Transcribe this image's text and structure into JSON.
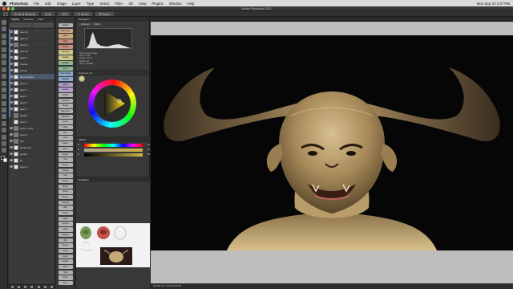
{
  "menubar": {
    "items": [
      "Photoshop",
      "File",
      "Edit",
      "Image",
      "Layer",
      "Type",
      "Select",
      "Filter",
      "3D",
      "View",
      "Plugins",
      "Window",
      "Help"
    ],
    "clock": "Mon Sep 23  2:37 PM"
  },
  "window": {
    "title": "Adobe Photoshop 2021"
  },
  "optionsbar": {
    "items": [
      "Scroll All Windows",
      "Zoom",
      "100%",
      "Fit Screen",
      "Fill Screen"
    ]
  },
  "layers": {
    "tabs": [
      "Layers",
      "Channels",
      "Paths"
    ],
    "rows": [
      {
        "name": "layer 12",
        "type": "layer",
        "visible": true,
        "selected": false
      },
      {
        "name": "layer 11",
        "type": "layer",
        "visible": true,
        "selected": false
      },
      {
        "name": "Group 1",
        "type": "folder",
        "visible": true,
        "selected": false
      },
      {
        "name": "layer 10",
        "type": "layer",
        "visible": true,
        "selected": false
      },
      {
        "name": "layer 9",
        "type": "layer",
        "visible": true,
        "selected": false
      },
      {
        "name": "Overlay",
        "type": "layer",
        "visible": true,
        "selected": false
      },
      {
        "name": "Curves",
        "type": "layer",
        "visible": true,
        "selected": false
      },
      {
        "name": "Base Shadow",
        "type": "layer",
        "visible": true,
        "selected": true
      },
      {
        "name": "layer 8",
        "type": "layer",
        "visible": true,
        "selected": false
      },
      {
        "name": "layer 7",
        "type": "layer",
        "visible": true,
        "selected": false
      },
      {
        "name": "layer 6",
        "type": "layer",
        "visible": true,
        "selected": false
      },
      {
        "name": "layer 5",
        "type": "layer",
        "visible": true,
        "selected": false
      },
      {
        "name": "layer 4",
        "type": "layer",
        "visible": true,
        "selected": false
      },
      {
        "name": "Sketch",
        "type": "folder",
        "visible": false,
        "selected": false
      },
      {
        "name": "layer 3",
        "type": "layer",
        "visible": false,
        "selected": false
      },
      {
        "name": "Layer 1 copy",
        "type": "dark",
        "visible": true,
        "selected": false
      },
      {
        "name": "Layer 1",
        "type": "dark",
        "visible": true,
        "selected": false
      },
      {
        "name": "refs",
        "type": "folder",
        "visible": true,
        "selected": false
      },
      {
        "name": "turnaround",
        "type": "layer",
        "visible": true,
        "selected": false
      },
      {
        "name": "portrait",
        "type": "layer",
        "visible": true,
        "selected": false
      },
      {
        "name": "bg",
        "type": "layer",
        "visible": true,
        "selected": false
      },
      {
        "name": "Layer 0",
        "type": "layer",
        "visible": true,
        "selected": false
      }
    ]
  },
  "actions": {
    "buttons": [
      {
        "label": "Actions",
        "color": "g"
      },
      {
        "label": "Symmetry",
        "color": "o"
      },
      {
        "label": "Flip H",
        "color": "o"
      },
      {
        "label": "Flip V",
        "color": "r"
      },
      {
        "label": "Rot 90",
        "color": "r"
      },
      {
        "label": "Soft Light",
        "color": "y"
      },
      {
        "label": "Overlay",
        "color": "y"
      },
      {
        "label": "Multiply",
        "color": "gr"
      },
      {
        "label": "Screen",
        "color": "gr"
      },
      {
        "label": "Color Dodge",
        "color": "b"
      },
      {
        "label": "Sharpen",
        "color": "b"
      },
      {
        "label": "Liquify",
        "color": "v"
      },
      {
        "label": "Levels",
        "color": "v"
      },
      {
        "label": "Curves",
        "color": "g"
      },
      {
        "label": "Hue/Sat",
        "color": "g"
      },
      {
        "label": "Merge",
        "color": "g"
      },
      {
        "label": "New Layer",
        "color": "g"
      },
      {
        "label": "Duplicate",
        "color": "g"
      },
      {
        "label": "Group",
        "color": "g"
      },
      {
        "label": "Mask",
        "color": "g"
      },
      {
        "label": "Clip",
        "color": "g"
      },
      {
        "label": "Lock",
        "color": "g"
      },
      {
        "label": "Flatten",
        "color": "g"
      },
      {
        "label": "Save",
        "color": "g"
      },
      {
        "label": "Export",
        "color": "g"
      },
      {
        "label": "Crop",
        "color": "g"
      },
      {
        "label": "Resize",
        "color": "g"
      },
      {
        "label": "Canvas",
        "color": "g"
      },
      {
        "label": "Grid",
        "color": "g"
      },
      {
        "label": "Guides",
        "color": "g"
      },
      {
        "label": "Rulers",
        "color": "g"
      },
      {
        "label": "Brush",
        "color": "g"
      },
      {
        "label": "Eraser",
        "color": "g"
      },
      {
        "label": "Smudge",
        "color": "g"
      },
      {
        "label": "Blur",
        "color": "g"
      },
      {
        "label": "Noise",
        "color": "g"
      },
      {
        "label": "Grain",
        "color": "g"
      },
      {
        "label": "Texture",
        "color": "g"
      },
      {
        "label": "Light",
        "color": "g"
      },
      {
        "label": "Shadow",
        "color": "g"
      },
      {
        "label": "Rim",
        "color": "g"
      },
      {
        "label": "Reset",
        "color": "g"
      },
      {
        "label": "Undo",
        "color": "g"
      },
      {
        "label": "Redo",
        "color": "g"
      },
      {
        "label": "Swatch",
        "color": "g"
      },
      {
        "label": "Picker",
        "color": "g"
      },
      {
        "label": "Hide",
        "color": "g"
      },
      {
        "label": "Show",
        "color": "g"
      },
      {
        "label": "Done",
        "color": "g"
      }
    ]
  },
  "histogram": {
    "tab": "Histogram",
    "channel_label": "Channel:",
    "channel_value": "RGB",
    "source_label": "Source:",
    "source_value": "Entire Image",
    "stats": [
      "Mean: 91.66",
      "Std Dev: 62.17",
      "Median: 90",
      "Pixels: 2904000"
    ]
  },
  "color": {
    "tab": "Coolorus 2.5"
  },
  "sliders": {
    "tab": "Sliders",
    "rows": [
      {
        "label": "H",
        "value": "45"
      },
      {
        "label": "S",
        "value": "72"
      },
      {
        "label": "B",
        "value": "88"
      }
    ]
  },
  "navigator": {
    "tab": "Navigator"
  },
  "document": {
    "tab_title": "demon portrait 1.psd @ 33.3% (Base Shadow, RGB/8)",
    "status": "33.33%    Doc: 16.6M/148.5M"
  },
  "colors": {
    "selection": "#4c5a6d",
    "accent": "#4a7ab8",
    "canvas_bg": "#060606",
    "pasteboard": "#bdbdbd"
  }
}
